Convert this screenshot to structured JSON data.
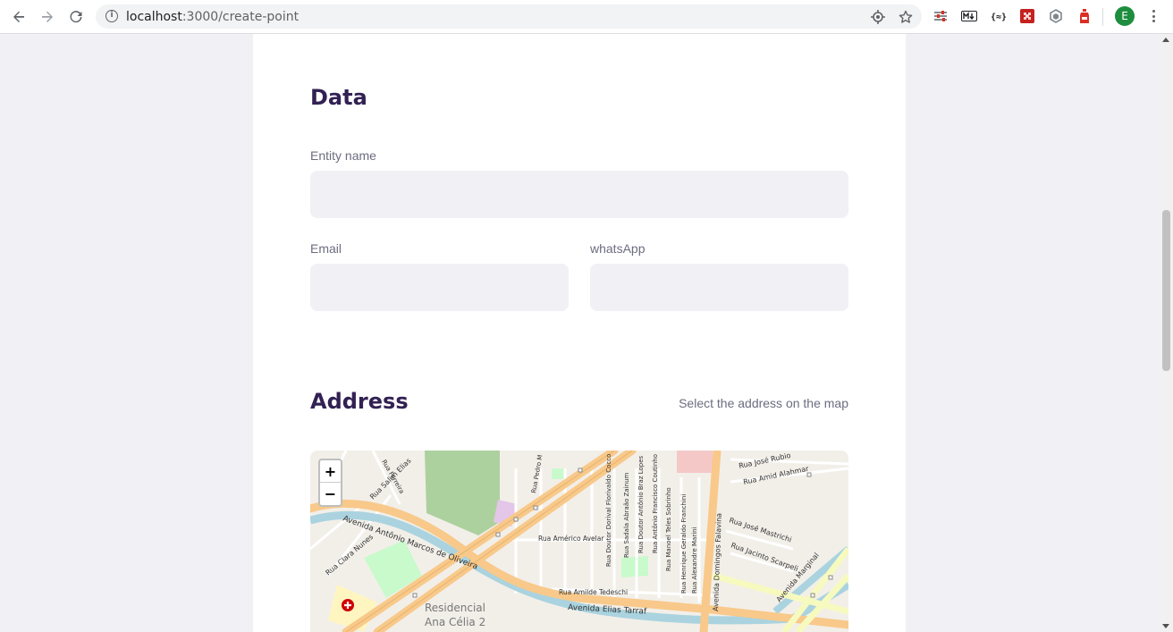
{
  "browser": {
    "url_host": "localhost",
    "url_path": ":3000/create-point",
    "avatar_letter": "E"
  },
  "form": {
    "data_section": {
      "title": "Data",
      "entity_name_label": "Entity name",
      "entity_name_value": "",
      "email_label": "Email",
      "email_value": "",
      "whatsapp_label": "whatsApp",
      "whatsapp_value": ""
    },
    "address_section": {
      "title": "Address",
      "hint": "Select the address on the map"
    }
  },
  "map": {
    "zoom_in": "+",
    "zoom_out": "−",
    "street_labels": [
      "Rua Salim Elias",
      "Avenida Antônio Marcos de Oliveira",
      "Rua Clara Nunes",
      "Rua Américo Avelar",
      "Rua Doutor Dorival Florivaldo Cocco",
      "Rua Sadala Abraão Zainum",
      "Rua Doutor Antônio Braz Lopes",
      "Rua Antônio Francisco Coutinho",
      "Rua Manoel Teles Sobrinho",
      "Rua Henrique Geraldo Franchini",
      "Rua Alexandre Marini",
      "Avenida Domingos Falavina",
      "Rua José Rubio",
      "Rua Amid Alahmar",
      "Rua José Mastrichi",
      "Rua Jacinto Scarpeli",
      "Avenida Marginal",
      "Rua Amilde Tedeschi",
      "Avenida Elias Tarraf",
      "Rua Ferreira",
      "Rua Pedro M",
      "Residencial",
      "Ana Célia 2"
    ]
  },
  "colors": {
    "title": "#322153",
    "label": "#6c6c80",
    "input_bg": "#f0f0f5",
    "page_bg": "#f0f0f5",
    "road_major": "#f8c98a",
    "river": "#aad3df",
    "park": "#add19e"
  },
  "icons": [
    "back-arrow-icon",
    "forward-arrow-icon",
    "reload-icon",
    "info-icon",
    "location-target-icon",
    "star-icon",
    "hospital-icon"
  ]
}
